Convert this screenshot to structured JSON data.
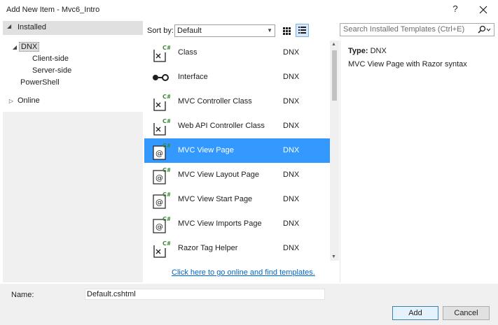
{
  "window": {
    "title": "Add New Item - Mvc6_Intro",
    "help_glyph": "?",
    "close_glyph": "✕"
  },
  "tree": {
    "installed": "Installed",
    "dnx": "DNX",
    "client_side": "Client-side",
    "server_side": "Server-side",
    "powershell": "PowerShell",
    "online": "Online"
  },
  "sort": {
    "label": "Sort by:",
    "value": "Default"
  },
  "search": {
    "placeholder": "Search Installed Templates (Ctrl+E)"
  },
  "templates": [
    {
      "name": "Class",
      "category": "DNX",
      "icon": "csharp-class-icon"
    },
    {
      "name": "Interface",
      "category": "DNX",
      "icon": "interface-icon"
    },
    {
      "name": "MVC Controller Class",
      "category": "DNX",
      "icon": "csharp-class-icon"
    },
    {
      "name": "Web API Controller Class",
      "category": "DNX",
      "icon": "csharp-class-icon"
    },
    {
      "name": "MVC View Page",
      "category": "DNX",
      "icon": "razor-page-icon",
      "selected": true
    },
    {
      "name": "MVC View Layout Page",
      "category": "DNX",
      "icon": "razor-page-icon"
    },
    {
      "name": "MVC View Start Page",
      "category": "DNX",
      "icon": "razor-page-icon"
    },
    {
      "name": "MVC View Imports Page",
      "category": "DNX",
      "icon": "razor-page-icon"
    },
    {
      "name": "Razor Tag Helper",
      "category": "DNX",
      "icon": "csharp-class-icon"
    }
  ],
  "online_link": "Click here to go online and find templates.",
  "details": {
    "type_label": "Type:",
    "type_value": "DNX",
    "description": "MVC View Page with Razor syntax"
  },
  "name_field": {
    "label": "Name:",
    "value": "Default.cshtml"
  },
  "buttons": {
    "add": "Add",
    "cancel": "Cancel"
  },
  "colors": {
    "selection": "#3399ff",
    "link": "#0066cc",
    "csharp_badge": "#388a34"
  }
}
